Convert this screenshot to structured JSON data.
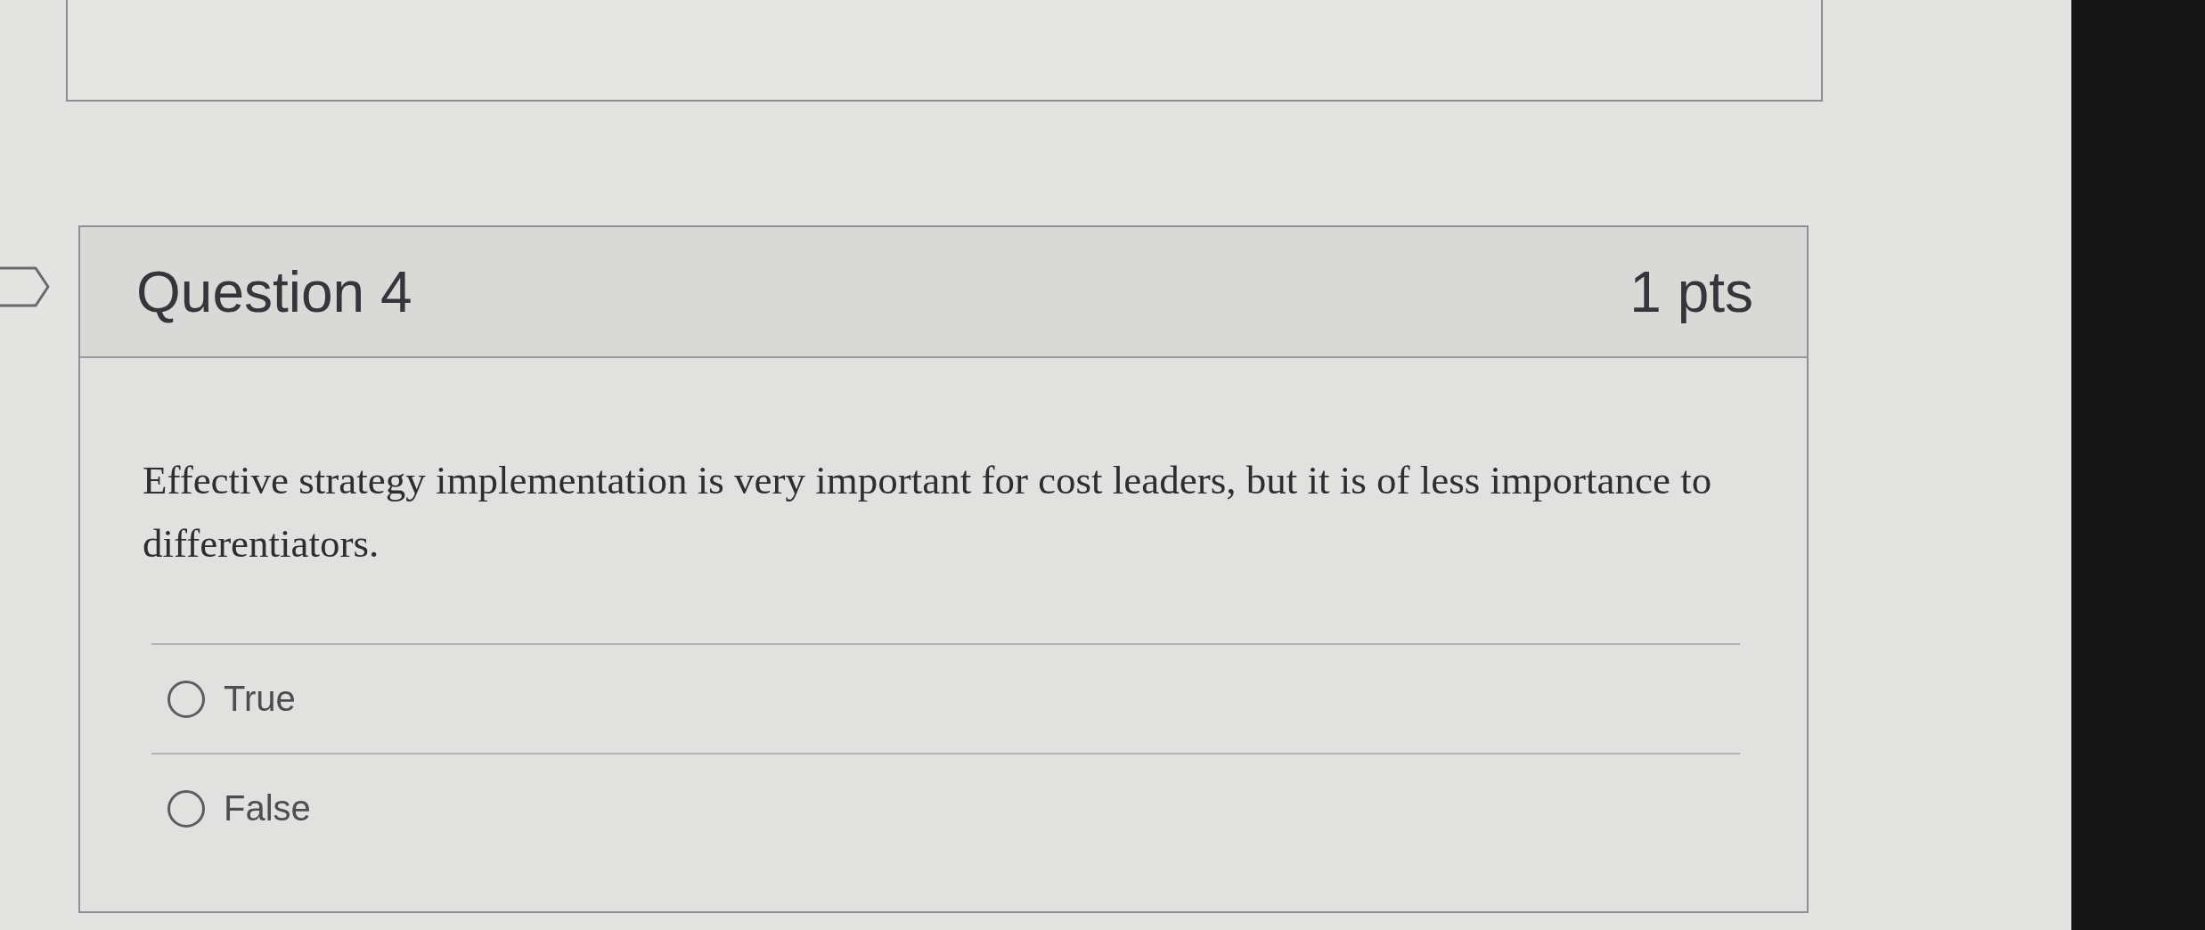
{
  "question": {
    "title": "Question 4",
    "points": "1 pts",
    "flagged": false,
    "text": "Effective strategy implementation is very important for cost leaders, but it is of less importance to differentiators.",
    "answers": [
      {
        "label": "True",
        "selected": false
      },
      {
        "label": "False",
        "selected": false
      }
    ]
  }
}
